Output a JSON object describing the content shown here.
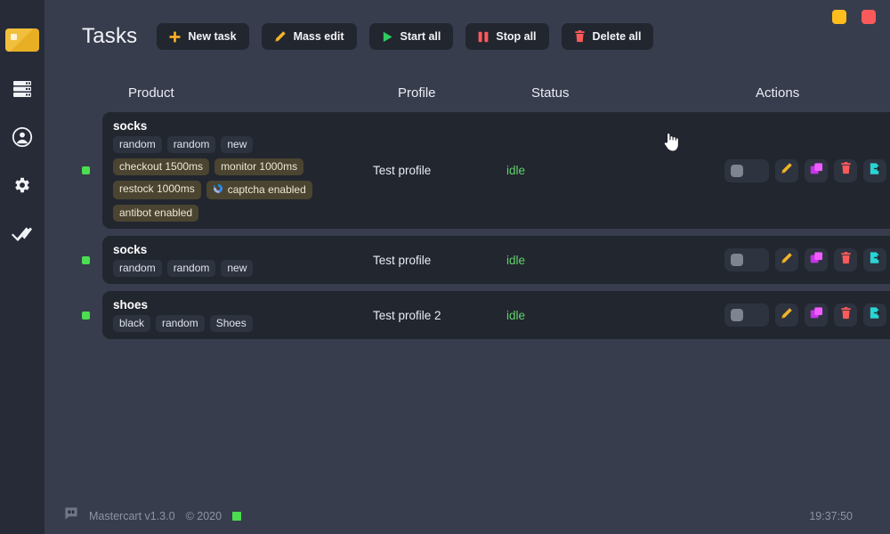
{
  "window": {
    "minimize_label": "minimize",
    "close_label": "close",
    "minimize_color": "#ffbe1d",
    "close_color": "#fc5a5a"
  },
  "sidebar": {
    "logo_name": "mastercart-logo",
    "items": [
      {
        "icon": "server-stack-icon",
        "label": "Tasks"
      },
      {
        "icon": "account-circle-icon",
        "label": "Profiles"
      },
      {
        "icon": "gear-icon",
        "label": "Settings"
      },
      {
        "icon": "double-check-icon",
        "label": "Checkouts"
      }
    ]
  },
  "header": {
    "title": "Tasks",
    "buttons": [
      {
        "label": "New task",
        "icon": "plus-icon",
        "color": "#ffb224"
      },
      {
        "label": "Mass edit",
        "icon": "pencil-icon",
        "color": "#f0b429"
      },
      {
        "label": "Start all",
        "icon": "play-icon",
        "color": "#2ecc5f"
      },
      {
        "label": "Stop all",
        "icon": "pause-icon",
        "color": "#fc5a5a"
      },
      {
        "label": "Delete all",
        "icon": "trash-icon",
        "color": "#fc5a5a"
      }
    ]
  },
  "table": {
    "columns": [
      "Product",
      "Profile",
      "Status",
      "Actions"
    ],
    "rows": [
      {
        "indicator_color": "#4ade50",
        "product": "socks",
        "tags": [
          "random",
          "random",
          "new"
        ],
        "settings_tags": [
          {
            "label": "checkout 1500ms",
            "icon": null
          },
          {
            "label": "monitor 1000ms",
            "icon": null
          },
          {
            "label": "restock 1000ms",
            "icon": null
          },
          {
            "label": "captcha enabled",
            "icon": "recaptcha-icon"
          },
          {
            "label": "antibot enabled",
            "icon": null
          }
        ],
        "profile": "Test profile",
        "status": "idle",
        "status_color": "#5fd36a"
      },
      {
        "indicator_color": "#4ade50",
        "product": "socks",
        "tags": [
          "random",
          "random",
          "new"
        ],
        "settings_tags": [],
        "profile": "Test profile",
        "status": "idle",
        "status_color": "#5fd36a"
      },
      {
        "indicator_color": "#4ade50",
        "product": "shoes",
        "tags": [
          "black",
          "random",
          "Shoes"
        ],
        "settings_tags": [],
        "profile": "Test profile 2",
        "status": "idle",
        "status_color": "#5fd36a"
      }
    ],
    "actions": [
      {
        "name": "stop-task-button",
        "icon": "stop-square-icon",
        "color": "#7e8490",
        "wide": true
      },
      {
        "name": "edit-task-button",
        "icon": "pencil-icon",
        "color": "#f0b429",
        "wide": false
      },
      {
        "name": "duplicate-task-button",
        "icon": "copy-icon",
        "color": "#e040fb",
        "wide": false
      },
      {
        "name": "delete-task-button",
        "icon": "trash-icon",
        "color": "#fc5a5a",
        "wide": false
      },
      {
        "name": "export-task-button",
        "icon": "file-export-icon",
        "color": "#2ad4d4",
        "wide": false
      }
    ]
  },
  "footer": {
    "discord_icon": "discord-icon",
    "app_name": "Mastercart v1.3.0",
    "copyright": "© 2020",
    "status_color": "#4ade50",
    "time": "19:37:50"
  }
}
